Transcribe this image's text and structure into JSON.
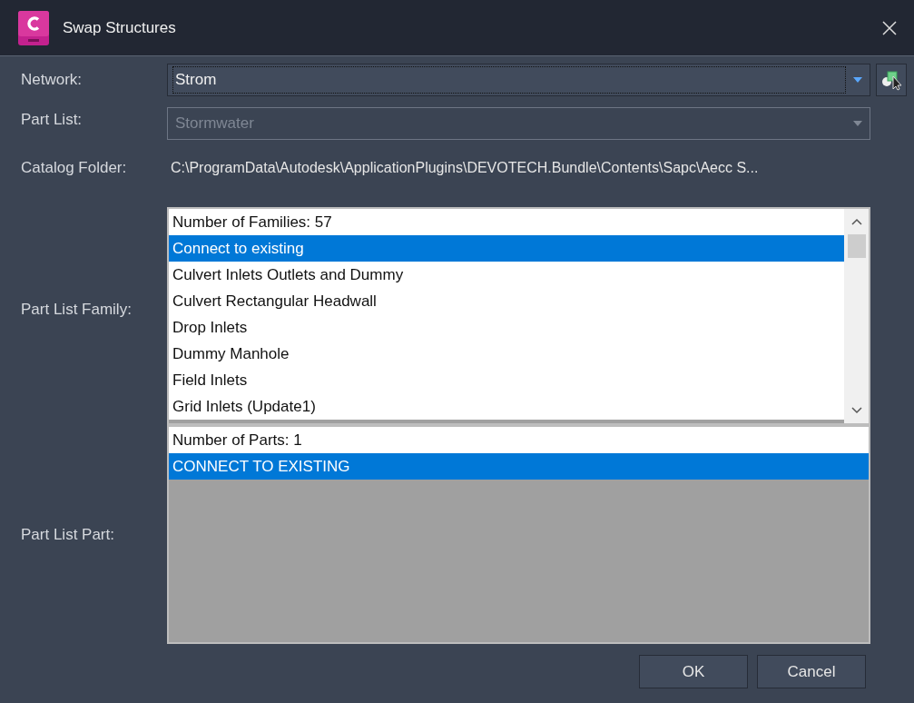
{
  "window": {
    "title": "Swap Structures"
  },
  "network": {
    "label": "Network:",
    "value": "Strom",
    "disabled": false
  },
  "part_list": {
    "label": "Part List:",
    "value": "Stormwater",
    "disabled": true
  },
  "catalog_folder": {
    "label": "Catalog Folder:",
    "value": "C:\\ProgramData\\Autodesk\\ApplicationPlugins\\DEVOTECH.Bundle\\Contents\\Sapc\\Aecc S..."
  },
  "part_list_family": {
    "label": "Part List Family:",
    "header": "Number of Families: 57",
    "items": [
      {
        "label": "Connect to existing",
        "selected": true
      },
      {
        "label": "Culvert Inlets Outlets and Dummy",
        "selected": false
      },
      {
        "label": "Culvert Rectangular Headwall",
        "selected": false
      },
      {
        "label": "Drop Inlets",
        "selected": false
      },
      {
        "label": "Dummy Manhole",
        "selected": false
      },
      {
        "label": "Field Inlets",
        "selected": false
      },
      {
        "label": "Grid Inlets (Update1)",
        "selected": false
      }
    ]
  },
  "part_list_part": {
    "label": "Part List Part:",
    "header": "Number of Parts: 1",
    "items": [
      {
        "label": "CONNECT TO EXISTING",
        "selected": true
      }
    ]
  },
  "buttons": [
    {
      "label": "OK"
    },
    {
      "label": "Cancel"
    }
  ]
}
